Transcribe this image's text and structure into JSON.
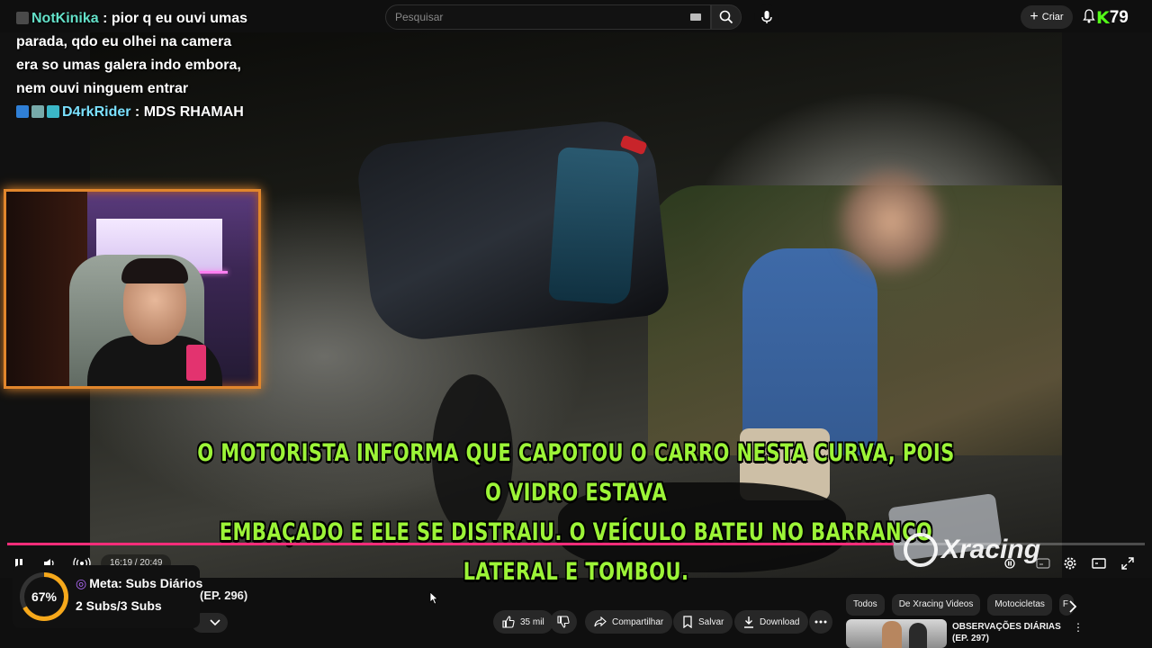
{
  "search": {
    "placeholder": "Pesquisar"
  },
  "header": {
    "create_label": "Criar",
    "kick_letter": "K",
    "kick_count": "79"
  },
  "chat": [
    {
      "user": "NotKinika",
      "message": "pior q eu ouvi umas parada, qdo eu olhei na camera era so umas galera indo embora, nem ouvi ninguem entrar"
    },
    {
      "user": "D4rkRider",
      "message": "MDS RHAMAH"
    }
  ],
  "video": {
    "subtitle_line1": "O MOTORISTA INFORMA QUE CAPOTOU O CARRO NESTA CURVA, POIS O VIDRO ESTAVA",
    "subtitle_line2": "EMBAÇADO E ELE SE DISTRAIU. O VEÍCULO BATEU NO BARRANCO LATERAL E TOMBOU.",
    "watermark": "Xracing",
    "time_display": "16:19 / 20:49",
    "progress_fraction": 0.779
  },
  "goal": {
    "percent_label": "67%",
    "percent_value": 0.67,
    "title": "Meta: Subs Diários",
    "progress_text": "2 Subs/3 Subs"
  },
  "video_info": {
    "title_fragment": "(EP. 296)",
    "likes": "35 mil",
    "share_label": "Compartilhar",
    "save_label": "Salvar",
    "download_label": "Download"
  },
  "sidebar": {
    "chips": [
      "Todos",
      "De Xracing Videos",
      "Motocicletas",
      "F"
    ],
    "recommendation": {
      "title": "OBSERVAÇÕES DIÁRIAS (EP. 297)"
    }
  },
  "colors": {
    "progress": "#ff2d7a",
    "subtitle": "#9cf437",
    "kick": "#53fc18",
    "goal_ring": "#f6a81b",
    "webcam_border": "#e1862c"
  }
}
